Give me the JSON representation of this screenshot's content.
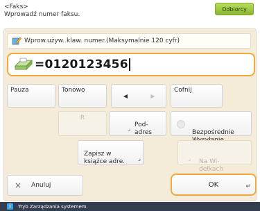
{
  "header": {
    "title": "<Faks>",
    "subtitle": "Wprowadź numer faksu.",
    "recipients_label": "Odbiorcy"
  },
  "info_bar": {
    "text": "Wprow.używ. klaw. numer.(Maksymalnie 120 cyfr)"
  },
  "number_field": {
    "value": "=0120123456"
  },
  "buttons": {
    "pause": "Pauza",
    "tone": "Tonowo",
    "arrow_left": "◀",
    "arrow_right": "▶",
    "backspace": "Cofnij",
    "r_key": "R",
    "subaddress": "Pod-\nadres",
    "direct_send": "Bezpośrednie\nWysyłanie",
    "save_address_book": "Zapisz w\nksiążce adre.",
    "in_line": "Na Wi-\ndełkach",
    "cancel": "Anuluj",
    "ok": "OK"
  },
  "status_bar": {
    "text": "Tryb Zarządzania systemem."
  },
  "colors": {
    "accent_orange": "#f0a93a",
    "recipients_green": "#9cc43f",
    "panel_bg": "#f4ecd8",
    "status_bar_bg": "#333d4f"
  }
}
